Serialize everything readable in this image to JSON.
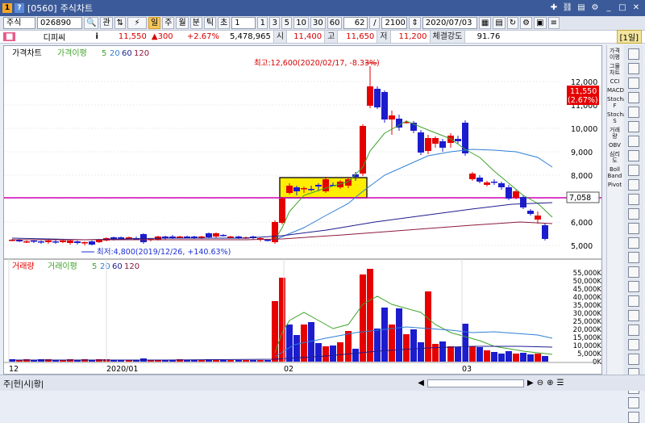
{
  "window": {
    "code": "[0560]",
    "title": "주식차트"
  },
  "toolbar": {
    "market": "주식",
    "stock_code": "026890",
    "btn_gwan": "관",
    "period_day": "일",
    "period_week": "주",
    "period_month": "월",
    "period_min": "분",
    "period_tick": "틱",
    "period_sec": "초",
    "interval": "1",
    "n1": "1",
    "n3": "3",
    "n5": "5",
    "n10": "10",
    "n30": "30",
    "n60": "60",
    "count": "62",
    "total": "2100",
    "date": "2020/07/03",
    "mode_btn": "[1일]"
  },
  "info": {
    "name": "디피씨",
    "price": "11,550",
    "change": "▲300",
    "change_pct": "+2.67%",
    "volume": "5,478,965",
    "open_label": "시",
    "open": "11,400",
    "high_label": "고",
    "high": "11,650",
    "low_label": "저",
    "low": "11,200",
    "strength_label": "체결강도",
    "strength": "91.76"
  },
  "price_legend": {
    "title": "가격차트",
    "ma_label": "가격이평",
    "ma5": "5",
    "ma20": "20",
    "ma60": "60",
    "ma120": "120"
  },
  "volume_legend": {
    "title": "거래량",
    "ma_label": "거래이평",
    "ma5": "5",
    "ma20": "20",
    "ma60": "60",
    "ma120": "120"
  },
  "annotations": {
    "high": "최고:12,600(2020/02/17, -8.33%)",
    "low": "최저:4,800(2019/12/26, +140.63%)"
  },
  "price_axis": [
    "12,000",
    "11,000",
    "10,000",
    "9,000",
    "8,000",
    "7,000",
    "6,000",
    "5,000"
  ],
  "price_current": "11,550",
  "price_current_pct": "(2.67%)",
  "hline_value": "7,058",
  "volume_axis": [
    "55,000K",
    "50,000K",
    "45,000K",
    "40,000K",
    "35,000K",
    "30,000K",
    "25,000K",
    "20,000K",
    "15,000K",
    "10,000K",
    "5,000K",
    "0K"
  ],
  "x_axis": [
    "12",
    "2020/01",
    "02",
    "03"
  ],
  "side_tools": [
    "가격이평",
    "그물차트",
    "CCI",
    "MACD",
    "Stochastic F",
    "Stochastic S",
    "거래량",
    "OBV",
    "심리도",
    "Boll Band",
    "Pivot"
  ],
  "bottom": {
    "tabs": "주|헌|시|황|"
  },
  "colors": {
    "up": "#e60000",
    "down": "#1c1ccf",
    "ma5": "#3fa32b",
    "ma20": "#2f7fd6",
    "ma60": "#1d1d8f",
    "ma120": "#8b1a3a",
    "hline": "#d100b8",
    "box": "#ffee00"
  }
}
